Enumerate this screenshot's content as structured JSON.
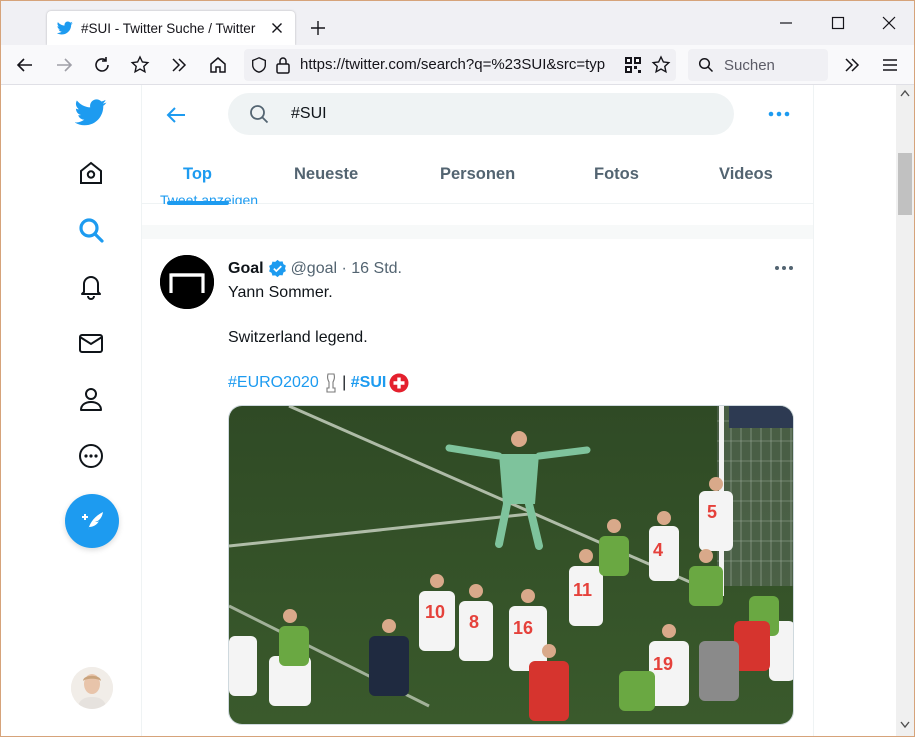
{
  "browser": {
    "tab_title": "#SUI - Twitter Suche / Twitter",
    "url": "https://twitter.com/search?q=%23SUI&src=typ",
    "search_placeholder": "Suchen"
  },
  "search": {
    "query": "#SUI"
  },
  "tabs": [
    {
      "label": "Top"
    },
    {
      "label": "Neueste"
    },
    {
      "label": "Personen"
    },
    {
      "label": "Fotos"
    },
    {
      "label": "Videos"
    }
  ],
  "peek_text": "Tweet anzeigen",
  "tweet": {
    "name": "Goal",
    "handle": "@goal",
    "separator": " · ",
    "time": "16 Std.",
    "line1": "Yann Sommer.",
    "line2": "Switzerland legend.",
    "hashtag1": "#EURO2020",
    "pipe": " | ",
    "hashtag2": "#SUI"
  },
  "colors": {
    "accent": "#1d9bf0",
    "text": "#0f1419",
    "muted": "#536471"
  },
  "icons": {
    "logo": "twitter-bird-icon",
    "home": "home-icon",
    "explore": "search-icon",
    "notifications": "bell-icon",
    "messages": "mail-icon",
    "profile": "person-icon",
    "more": "more-circle-icon",
    "compose": "compose-tweet-icon"
  }
}
